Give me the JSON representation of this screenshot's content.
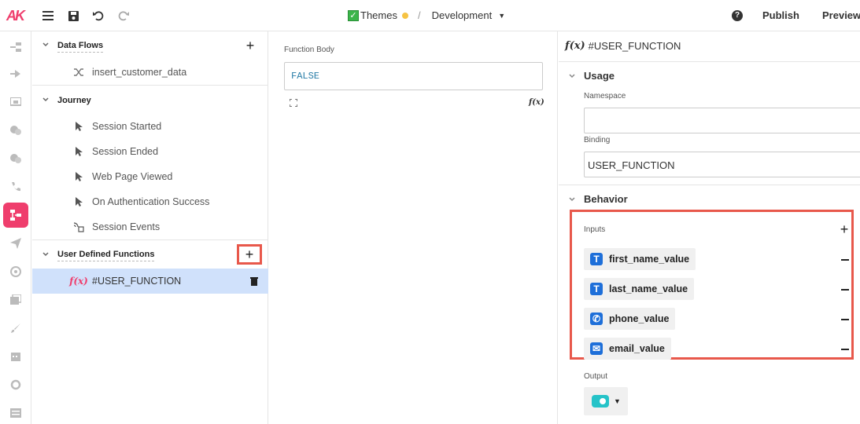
{
  "topbar": {
    "logo": "AK",
    "themes_label": "Themes",
    "separator": "/",
    "environment": "Development",
    "help": "?",
    "publish_label": "Publish",
    "preview_label": "Preview"
  },
  "rail": {
    "icons": [
      "entry-points-icon",
      "transition-icon",
      "screen-icon",
      "chat-icon",
      "conversation-icon",
      "phone-icon",
      "data-flow-icon",
      "send-icon",
      "settings-icon",
      "gallery-icon",
      "brush-icon",
      "calendar-icon",
      "sync-icon",
      "list-icon"
    ],
    "active": "data-flow-icon"
  },
  "tree": {
    "data_flows": {
      "title": "Data Flows",
      "items": [
        {
          "label": "insert_customer_data",
          "icon": "shuffle-icon"
        }
      ]
    },
    "journey": {
      "title": "Journey",
      "items": [
        {
          "label": "Session Started",
          "icon": "pointer-icon"
        },
        {
          "label": "Session Ended",
          "icon": "pointer-icon"
        },
        {
          "label": "Web Page Viewed",
          "icon": "pointer-icon"
        },
        {
          "label": "On Authentication Success",
          "icon": "pointer-icon"
        },
        {
          "label": "Session Events",
          "icon": "events-icon"
        }
      ]
    },
    "udf": {
      "title": "User Defined Functions",
      "items": [
        {
          "label": "#USER_FUNCTION",
          "icon": "fx-icon",
          "fx": "f(x)"
        }
      ]
    }
  },
  "middle": {
    "label": "Function Body",
    "code": "FALSE",
    "fx": "f(x)"
  },
  "right": {
    "fx": "f(x)",
    "title": "#USER_FUNCTION",
    "usage": {
      "title": "Usage",
      "namespace_label": "Namespace",
      "namespace_value": "",
      "binding_label": "Binding",
      "binding_value": "USER_FUNCTION"
    },
    "behavior": {
      "title": "Behavior",
      "inputs_label": "Inputs",
      "inputs": [
        {
          "label": "first_name_value",
          "type": "text",
          "glyph": "T"
        },
        {
          "label": "last_name_value",
          "type": "text",
          "glyph": "T"
        },
        {
          "label": "phone_value",
          "type": "phone",
          "glyph": "✆"
        },
        {
          "label": "email_value",
          "type": "email",
          "glyph": "✉"
        }
      ],
      "output_label": "Output",
      "output_type": "boolean"
    }
  },
  "colors": {
    "brand": "#ef3e6d",
    "highlight": "#e8584b",
    "selected": "#d0e1fb",
    "type_icon": "#1e6fd9",
    "toggle": "#25c3c8"
  }
}
